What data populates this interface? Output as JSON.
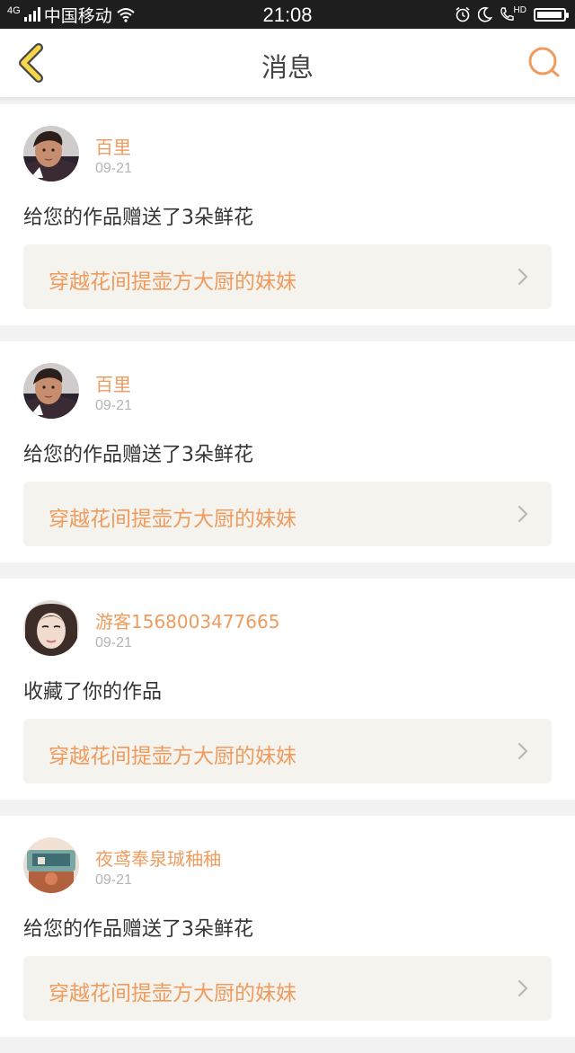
{
  "status_bar": {
    "network": "4G",
    "carrier": "中国移动",
    "time": "21:08",
    "hd_label": "HD",
    "battery_level": 0.95
  },
  "header": {
    "title": "消息"
  },
  "colors": {
    "accent": "#ef9b5e",
    "back_icon_fill": "#f5d54a",
    "back_icon_stroke": "#444444"
  },
  "messages": [
    {
      "user": "百里",
      "date": "09-21",
      "text": "给您的作品赠送了3朵鲜花",
      "work": "穿越花间提壶方大厨的妹妹",
      "avatar": "avatar-boy"
    },
    {
      "user": "百里",
      "date": "09-21",
      "text": "给您的作品赠送了3朵鲜花",
      "work": "穿越花间提壶方大厨的妹妹",
      "avatar": "avatar-boy"
    },
    {
      "user": "游客1568003477665",
      "date": "09-21",
      "text": "收藏了你的作品",
      "work": "穿越花间提壶方大厨的妹妹",
      "avatar": "avatar-girl"
    },
    {
      "user": "夜鸢奉泉珹秞秞",
      "date": "09-21",
      "text": "给您的作品赠送了3朵鲜花",
      "work": "穿越花间提壶方大厨的妹妹",
      "avatar": "avatar-photo"
    }
  ]
}
